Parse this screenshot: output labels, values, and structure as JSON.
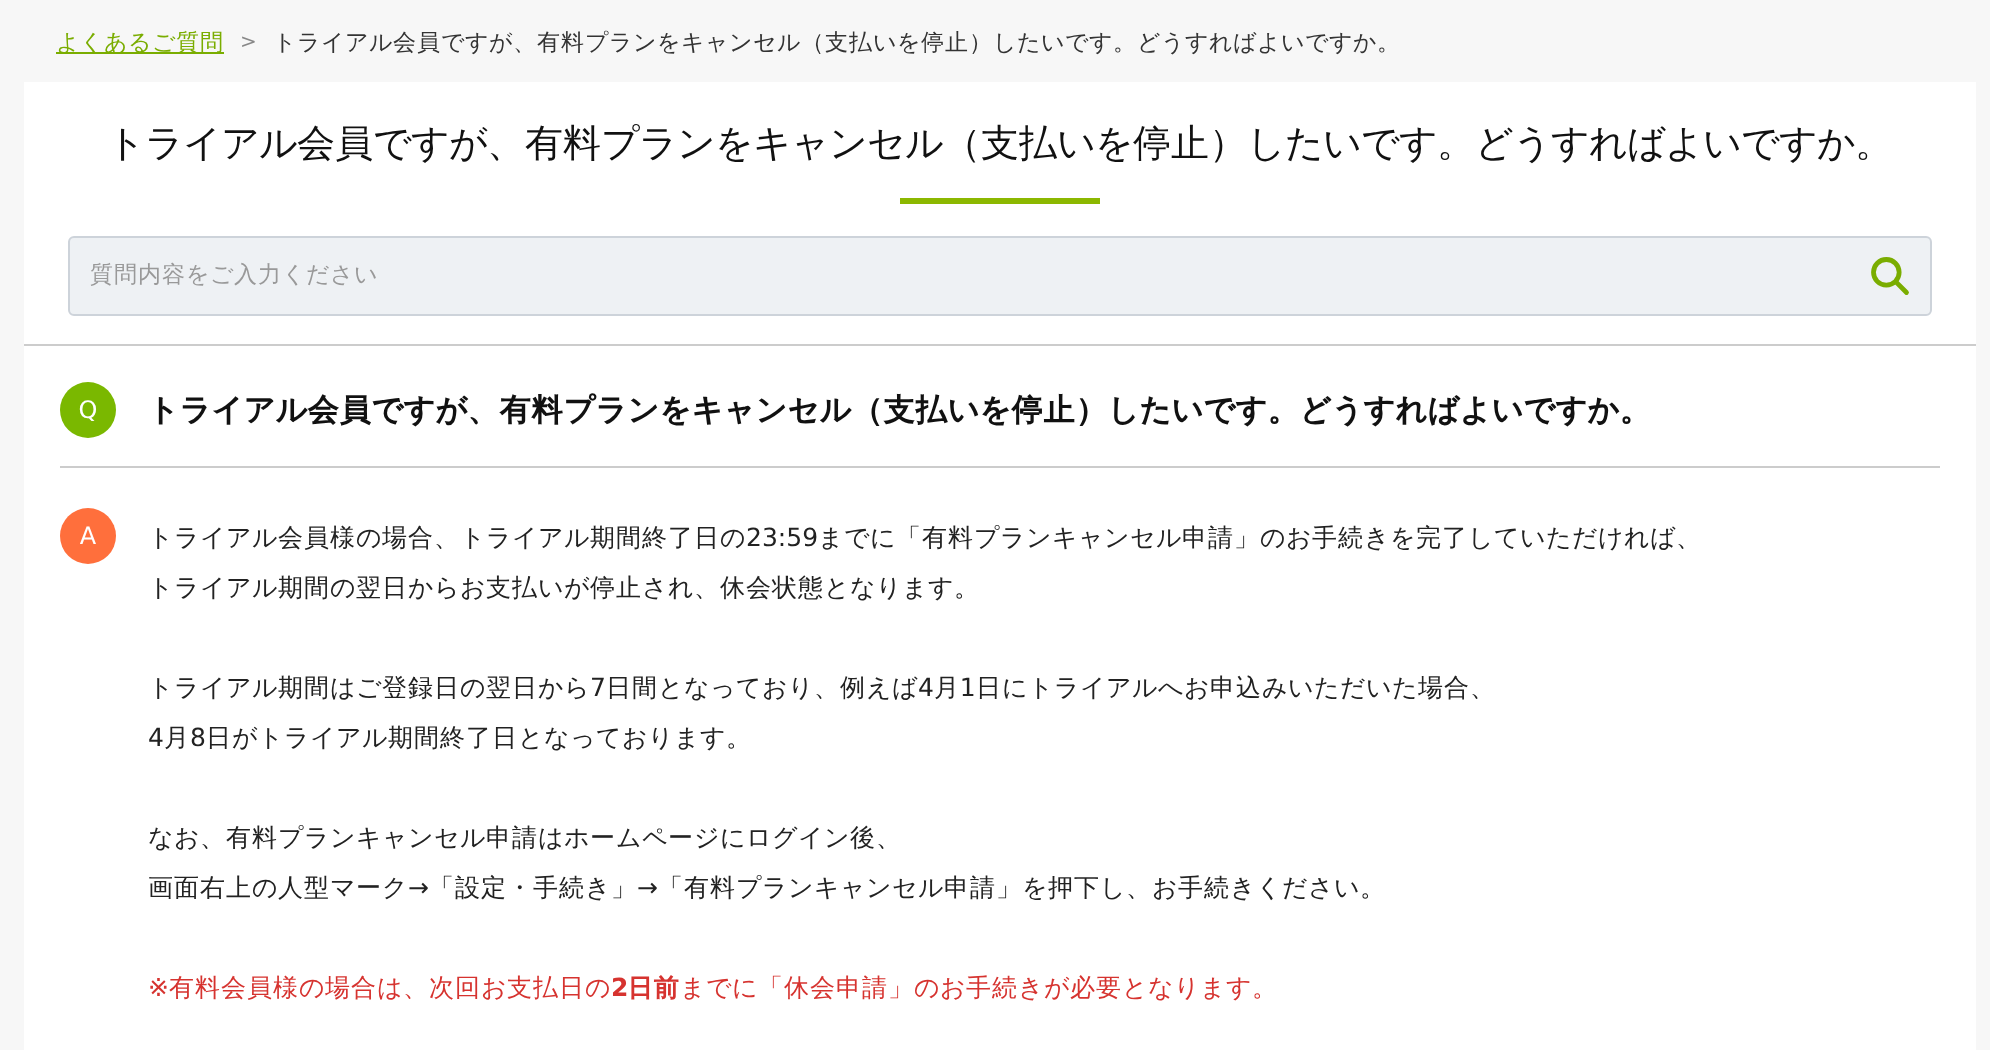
{
  "breadcrumb": {
    "link": "よくあるご質問",
    "separator": ">",
    "current": "トライアル会員ですが、有料プランをキャンセル（支払いを停止）したいです。どうすればよいですか。"
  },
  "page_title": "トライアル会員ですが、有料プランをキャンセル（支払いを停止）したいです。どうすればよいですか。",
  "search": {
    "placeholder": "質問内容をご入力ください"
  },
  "question": {
    "badge": "Q",
    "text": "トライアル会員ですが、有料プランをキャンセル（支払いを停止）したいです。どうすればよいですか。"
  },
  "answer": {
    "badge": "A",
    "paragraphs": [
      {
        "kind": "normal",
        "lines": [
          "トライアル会員様の場合、トライアル期間終了日の23:59までに「有料プランキャンセル申請」のお手続きを完了していただければ、",
          "トライアル期間の翌日からお支払いが停止され、休会状態となります。"
        ]
      },
      {
        "kind": "normal",
        "lines": [
          "トライアル期間はご登録日の翌日から7日間となっており、例えば4月1日にトライアルへお申込みいただいた場合、",
          "4月8日がトライアル期間終了日となっております。"
        ]
      },
      {
        "kind": "normal",
        "lines": [
          "なお、有料プランキャンセル申請はホームページにログイン後、",
          "画面右上の人型マーク→「設定・手続き」→「有料プランキャンセル申請」を押下し、お手続きください。"
        ]
      },
      {
        "kind": "note",
        "lines": [
          "※有料会員様の場合は、次回お支払日の**2日前**までに「休会申請」のお手続きが必要となります。"
        ]
      }
    ]
  }
}
